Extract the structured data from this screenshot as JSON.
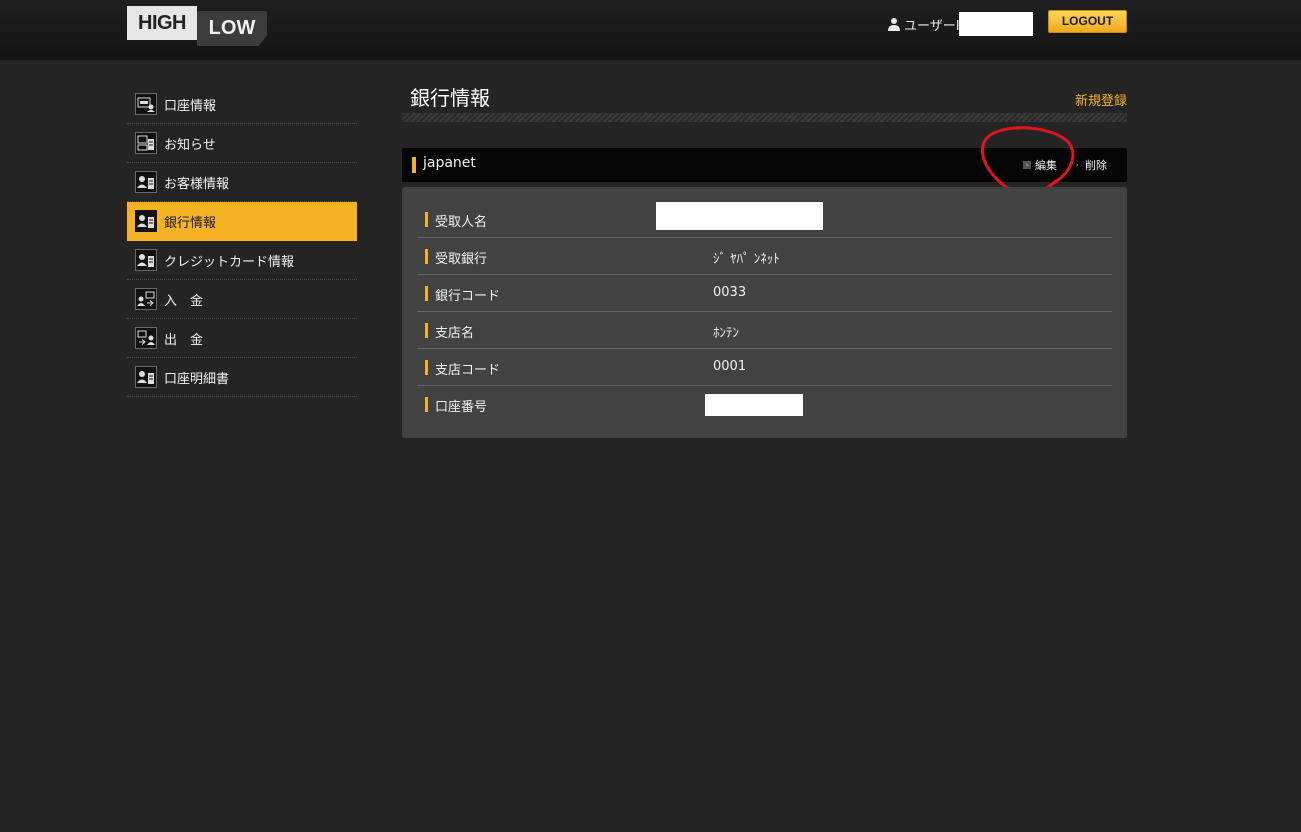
{
  "header": {
    "logo": {
      "high": "HIGH",
      "low": "LOW"
    },
    "user_label": "ユーザーI",
    "logout_label": "LOGOUT"
  },
  "sidebar": {
    "items": [
      {
        "label": "口座情報",
        "icon": "account-info-icon",
        "active": false
      },
      {
        "label": "お知らせ",
        "icon": "notice-icon",
        "active": false
      },
      {
        "label": "お客様情報",
        "icon": "customer-info-icon",
        "active": false
      },
      {
        "label": "銀行情報",
        "icon": "bank-info-icon",
        "active": true
      },
      {
        "label": "クレジットカード情報",
        "icon": "credit-card-icon",
        "active": false
      },
      {
        "label": "入　金",
        "icon": "deposit-icon",
        "active": false
      },
      {
        "label": "出　金",
        "icon": "withdraw-icon",
        "active": false
      },
      {
        "label": "口座明細書",
        "icon": "statement-icon",
        "active": false
      }
    ]
  },
  "main": {
    "title": "銀行情報",
    "new_link": "新規登録",
    "bank": {
      "name": "japanet",
      "edit_label": "編集",
      "delete_label": "削除"
    },
    "details": [
      {
        "label": "受取人名",
        "value": ""
      },
      {
        "label": "受取銀行",
        "value": "ｼﾞ ﾔﾊﾟ ﾝﾈｯﾄ"
      },
      {
        "label": "銀行コード",
        "value": "0033"
      },
      {
        "label": "支店名",
        "value": "ﾎﾝﾃﾝ"
      },
      {
        "label": "支店コード",
        "value": "0001"
      },
      {
        "label": "口座番号",
        "value": ""
      }
    ]
  },
  "colors": {
    "accent": "#f5b324",
    "background": "#242424",
    "panel": "#424242",
    "annotation": "#e0141e"
  }
}
